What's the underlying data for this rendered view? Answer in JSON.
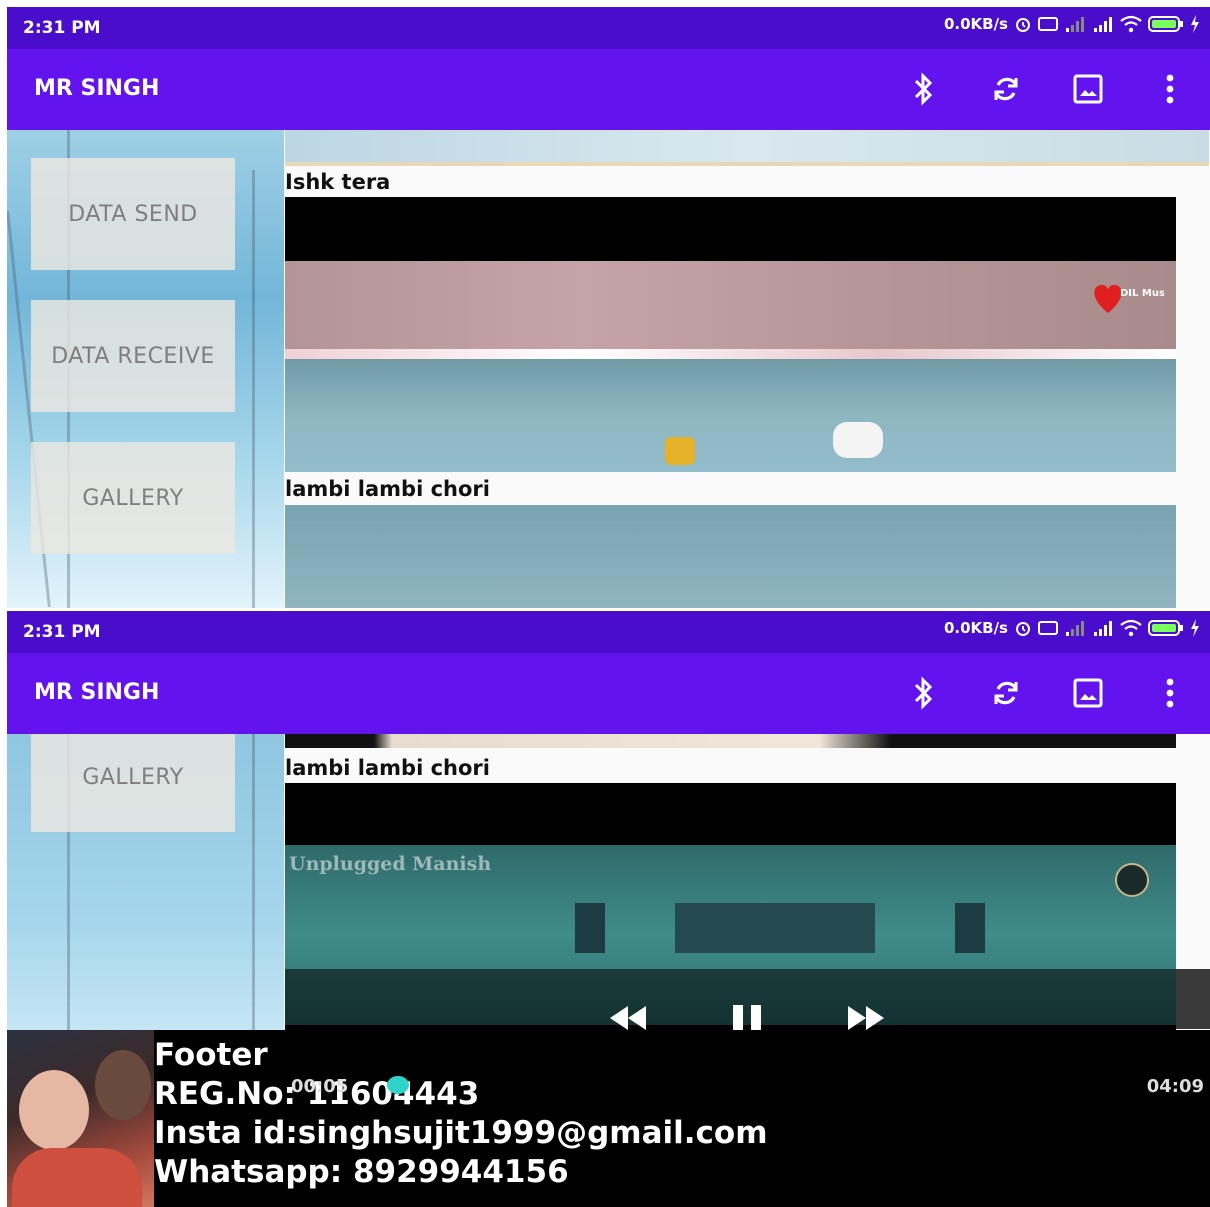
{
  "status_bar": {
    "time": "2:31 PM",
    "network_speed": "0.0KB/s",
    "icons": [
      "alarm-icon",
      "hd-voice-icon",
      "signal-weak-icon",
      "signal-icon",
      "wifi-icon",
      "battery-icon",
      "charging-icon"
    ],
    "battery": "98"
  },
  "app_bar": {
    "title": "MR SINGH",
    "actions": [
      "bluetooth-icon",
      "sync-icon",
      "image-icon",
      "overflow-menu-icon"
    ]
  },
  "sidebar": {
    "buttons": [
      {
        "label": "DATA SEND"
      },
      {
        "label": "DATA RECEIVE"
      },
      {
        "label": "GALLERY"
      }
    ]
  },
  "songs": [
    {
      "title": "Ishk tera",
      "thumbnail_label": "DIL Music"
    },
    {
      "title": "lambi lambi chori",
      "thumbnail_label": "Unplugged Manish"
    }
  ],
  "player": {
    "controls": [
      "rewind-icon",
      "pause-icon",
      "fast-forward-icon"
    ],
    "elapsed": "00:05",
    "total": "04:09",
    "progress": 0.02
  },
  "footer": {
    "heading": "Footer",
    "reg_no": "REG.No: 11604443",
    "insta": "Insta id:singhsujit1999@gmail.com",
    "whatsapp": "Whatsapp: 8929944156"
  },
  "colors": {
    "status_bar": "#4a0dcc",
    "app_bar": "#6213ee",
    "seek_accent": "#2fd3c8"
  }
}
